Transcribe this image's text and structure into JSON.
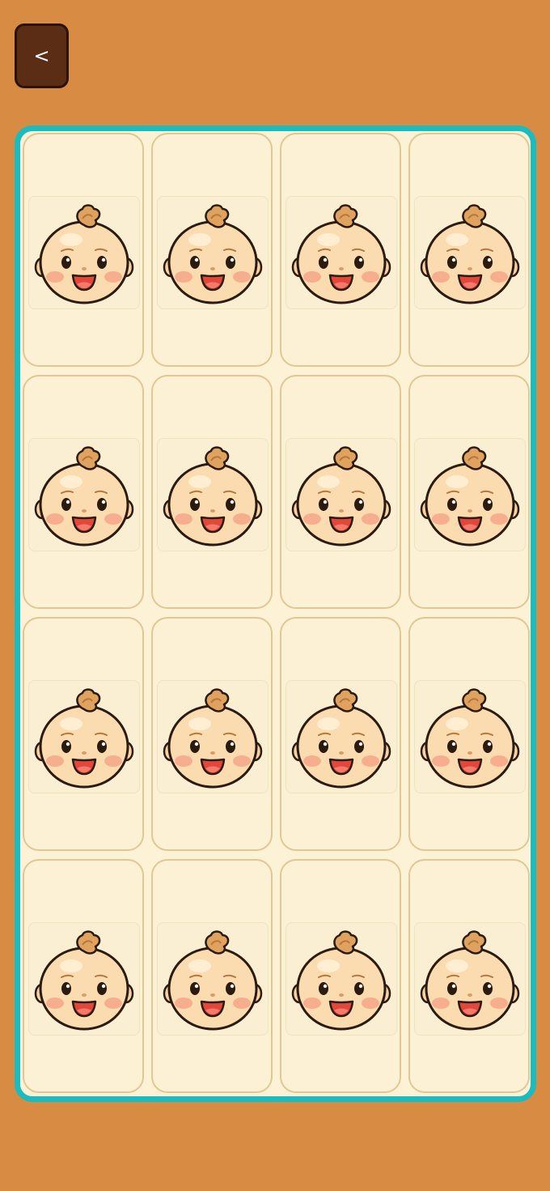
{
  "header": {
    "back_label": "<"
  },
  "board": {
    "rows": 4,
    "columns": 4,
    "cards": [
      {
        "face": "baby-face-icon"
      },
      {
        "face": "baby-face-icon"
      },
      {
        "face": "baby-face-icon"
      },
      {
        "face": "baby-face-icon"
      },
      {
        "face": "baby-face-icon"
      },
      {
        "face": "baby-face-icon"
      },
      {
        "face": "baby-face-icon"
      },
      {
        "face": "baby-face-icon"
      },
      {
        "face": "baby-face-icon"
      },
      {
        "face": "baby-face-icon"
      },
      {
        "face": "baby-face-icon"
      },
      {
        "face": "baby-face-icon"
      },
      {
        "face": "baby-face-icon"
      },
      {
        "face": "baby-face-icon"
      },
      {
        "face": "baby-face-icon"
      },
      {
        "face": "baby-face-icon"
      }
    ]
  },
  "colors": {
    "background": "#d88b42",
    "back_button": "#5a2d14",
    "board_border": "#1bbcbf",
    "card_fill": "#fcf1d5",
    "card_border": "#dfc891"
  }
}
